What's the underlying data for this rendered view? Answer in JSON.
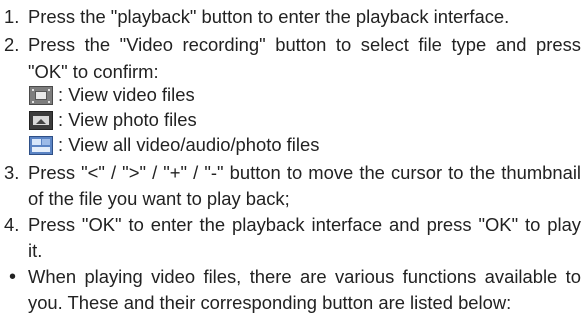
{
  "items": [
    {
      "number": "1.",
      "lines": [
        "Press the \"playback\" button to enter the playback interface."
      ]
    },
    {
      "number": "2.",
      "lines": [
        "Press the \"Video recording\" button to select file type and press",
        "\"OK\" to confirm:"
      ]
    },
    {
      "number": "3.",
      "lines": [
        "Press \"<\" / \">\" / \"+\" / \"-\" button to move the cursor to the thumbnail",
        "of the file you want to play back;"
      ]
    },
    {
      "number": "4.",
      "lines": [
        "Press \"OK\" to enter the playback interface and press \"OK\" to play",
        "it."
      ]
    }
  ],
  "file_types": [
    {
      "icon": "video-file-icon",
      "label": ": View video files"
    },
    {
      "icon": "photo-file-icon",
      "label": ": View photo files"
    },
    {
      "icon": "all-files-icon",
      "label": ": View all video/audio/photo files"
    }
  ],
  "bullet": {
    "symbol": "•",
    "lines": [
      "When playing video files, there are various functions available to",
      "you. These and their corresponding button are listed below:"
    ]
  }
}
